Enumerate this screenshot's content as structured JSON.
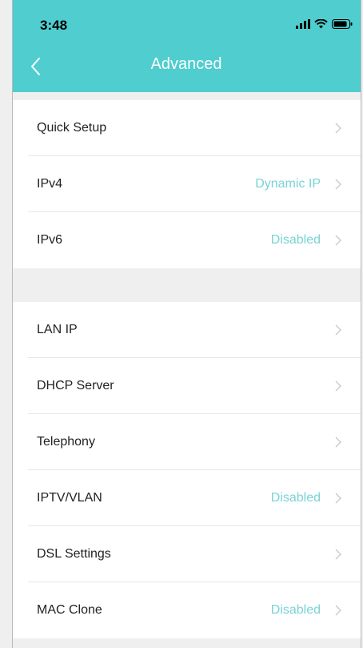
{
  "status_bar": {
    "time": "3:48",
    "icons": [
      "signal-icon",
      "wifi-icon",
      "battery-icon"
    ]
  },
  "nav": {
    "title": "Advanced",
    "back_icon": "chevron-left-icon"
  },
  "colors": {
    "header": "#4fcdcf",
    "value_text": "#79d3d5",
    "background": "#efefef"
  },
  "groups": [
    {
      "items": [
        {
          "label": "Quick Setup",
          "value": ""
        },
        {
          "label": "IPv4",
          "value": "Dynamic IP"
        },
        {
          "label": "IPv6",
          "value": "Disabled"
        }
      ]
    },
    {
      "items": [
        {
          "label": "LAN IP",
          "value": ""
        },
        {
          "label": "DHCP Server",
          "value": ""
        },
        {
          "label": "Telephony",
          "value": ""
        },
        {
          "label": "IPTV/VLAN",
          "value": "Disabled"
        },
        {
          "label": "DSL Settings",
          "value": ""
        },
        {
          "label": "MAC Clone",
          "value": "Disabled"
        }
      ]
    }
  ]
}
